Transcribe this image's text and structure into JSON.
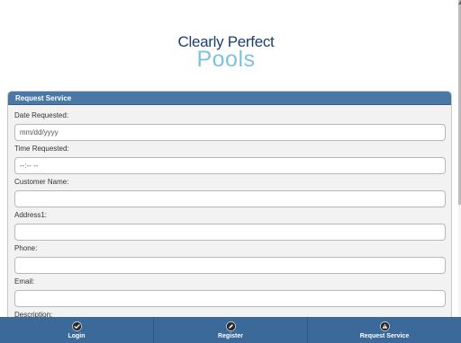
{
  "logo": {
    "line1": "Clearly Perfect",
    "line2": "Pools"
  },
  "panel": {
    "title": "Request Service"
  },
  "fields": [
    {
      "label": "Date Requested:",
      "placeholder": "mm/dd/yyyy"
    },
    {
      "label": "Time Requested:",
      "placeholder": "--:-- --"
    },
    {
      "label": "Customer Name:",
      "placeholder": ""
    },
    {
      "label": "Address1:",
      "placeholder": ""
    },
    {
      "label": "Phone:",
      "placeholder": ""
    },
    {
      "label": "Email:",
      "placeholder": ""
    },
    {
      "label": "Description:",
      "placeholder": ""
    }
  ],
  "nav": [
    {
      "label": "Login",
      "icon": "check-circle-icon"
    },
    {
      "label": "Register",
      "icon": "pencil-icon"
    },
    {
      "label": "Request Service",
      "icon": "alert-triangle-icon"
    }
  ],
  "colors": {
    "header": "#4a78a6",
    "navbar": "#3b6a9a",
    "logo_dark": "#1d3f6e",
    "logo_light": "#7ec3dd"
  }
}
